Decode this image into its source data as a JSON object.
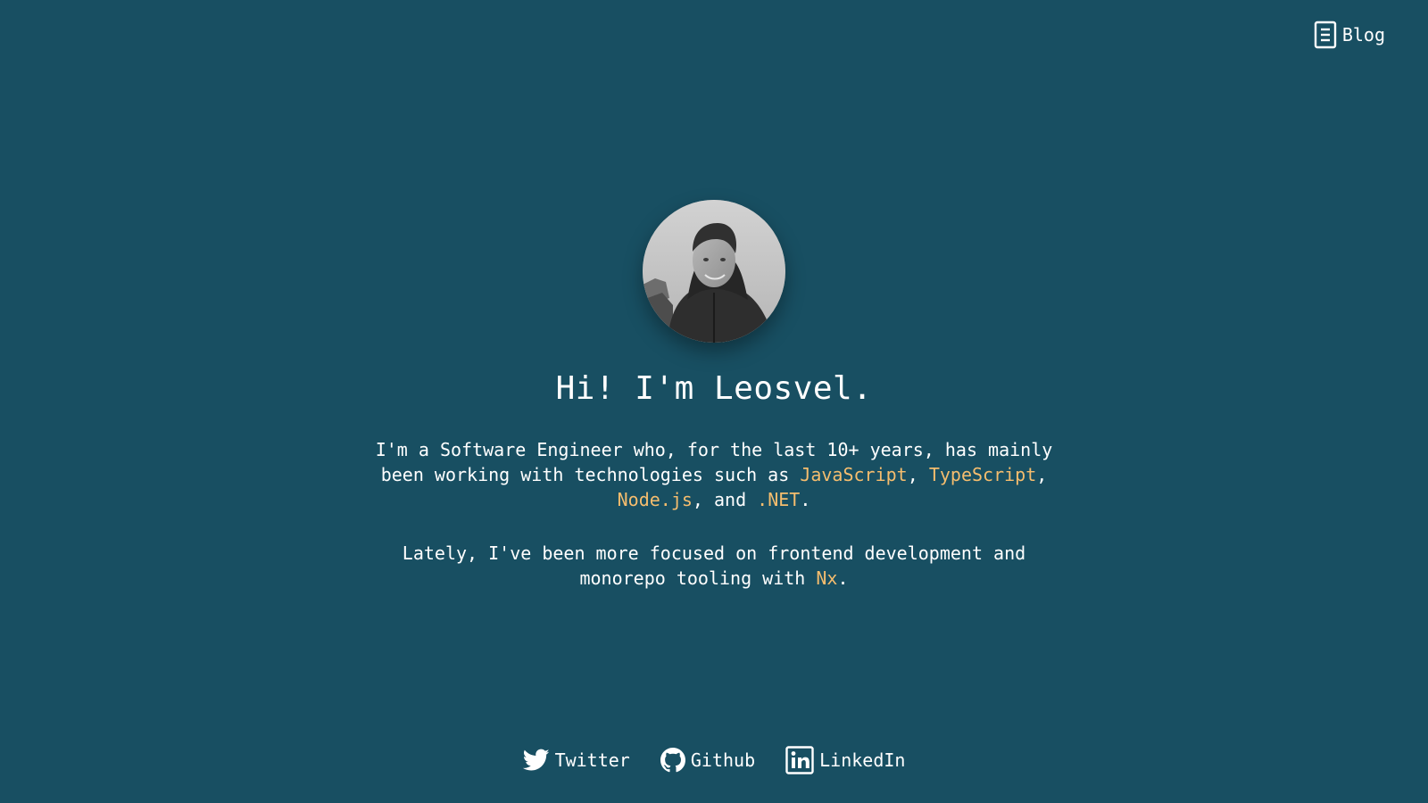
{
  "header": {
    "blog_label": "Blog",
    "blog_icon": "document-icon"
  },
  "profile": {
    "avatar": "profile-photo",
    "title": "Hi! I'm Leosvel."
  },
  "bio": {
    "p1": {
      "t1": "I'm a Software Engineer who, for the last 10+ years, has mainly been working with technologies such as ",
      "tech1": "JavaScript",
      "sep1": ", ",
      "tech2": "TypeScript",
      "sep2": ", ",
      "tech3": "Node.js",
      "sep3": ", and ",
      "tech4": ".NET",
      "end": "."
    },
    "p2": {
      "t1": "Lately, I've been more focused on frontend development and monorepo tooling with ",
      "tech1": "Nx",
      "end": "."
    }
  },
  "socials": [
    {
      "label": "Twitter",
      "icon": "twitter-icon"
    },
    {
      "label": "Github",
      "icon": "github-icon"
    },
    {
      "label": "LinkedIn",
      "icon": "linkedin-icon"
    }
  ],
  "colors": {
    "background": "#184f62",
    "text": "#ffffff",
    "highlight": "#f5bd6e"
  }
}
